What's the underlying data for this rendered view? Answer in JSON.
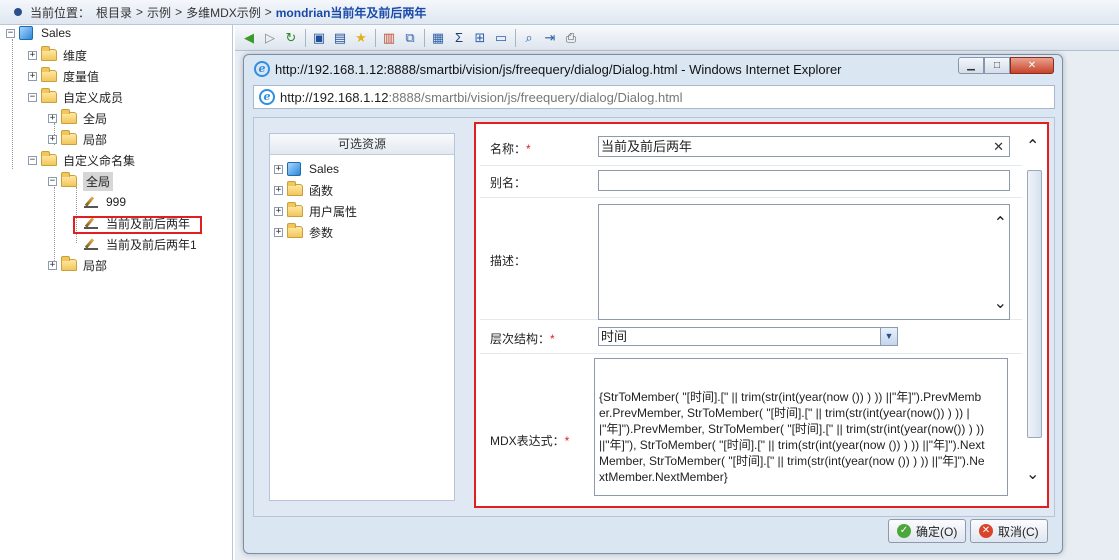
{
  "breadcrumb": {
    "prefix": "当前位置：",
    "items": [
      "根目录",
      "示例",
      "多维MDX示例"
    ],
    "current": "mondrian当前年及前后两年",
    "separator": ">"
  },
  "tree": {
    "root": "Sales",
    "dims": "维度",
    "measures": "度量值",
    "custom_members": "自定义成员",
    "cm_global": "全局",
    "cm_local": "局部",
    "custom_sets": "自定义命名集",
    "cs_global": "全局",
    "set1": "999",
    "set2": "当前及前后两年",
    "set3": "当前及前后两年1",
    "cs_local": "局部"
  },
  "dialog": {
    "title": "http://192.168.1.12:8888/smartbi/vision/js/freequery/dialog/Dialog.html - Windows Internet Explorer",
    "address_host": "http://192.168.1.12",
    "address_path": ":8888/smartbi/vision/js/freequery/dialog/Dialog.html"
  },
  "resources": {
    "header": "可选资源",
    "items": [
      "Sales",
      "函数",
      "用户属性",
      "参数"
    ]
  },
  "form": {
    "name_label": "名称：",
    "name_value": "当前及前后两年",
    "alias_label": "别名：",
    "alias_value": "",
    "desc_label": "描述：",
    "hier_label": "层次结构：",
    "hier_value": "时间",
    "mdx_label": "MDX表达式：",
    "mdx_value": "{StrToMember( \"[时间].[\" || trim(str(int(year(now ()) ) )) ||\"年]\").PrevMember.PrevMember, StrToMember( \"[时间].[\" || trim(str(int(year(now()) ) )) ||\"年]\").PrevMember, StrToMember( \"[时间].[\" || trim(str(int(year(now()) ) )) ||\"年]\"), StrToMember( \"[时间].[\" || trim(str(int(year(now ()) ) )) ||\"年]\").NextMember,  StrToMember( \"[时间].[\" || trim(str(int(year(now ()) ) )) ||\"年]\").NextMember.NextMember}",
    "required_mark": "*"
  },
  "buttons": {
    "ok": "确定(O)",
    "cancel": "取消(C)"
  },
  "colors": {
    "highlight": "#e02020",
    "accent": "#1a4aa8"
  }
}
